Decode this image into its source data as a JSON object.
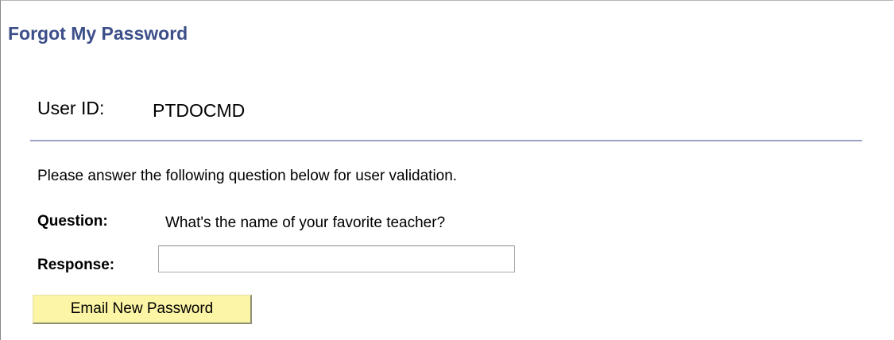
{
  "page": {
    "title": "Forgot My Password"
  },
  "user": {
    "label": "User ID:",
    "value": "PTDOCMD"
  },
  "validation": {
    "instructions": "Please answer the following question below for user validation.",
    "question_label": "Question:",
    "question_text": "What's the name of your favorite teacher?",
    "response_label": "Response:",
    "response_value": "",
    "response_placeholder": ""
  },
  "actions": {
    "email_button_label": "Email New Password"
  },
  "colors": {
    "title": "#3c4f89",
    "divider": "#9aa3c6",
    "button_background": "#fcf5a5"
  }
}
